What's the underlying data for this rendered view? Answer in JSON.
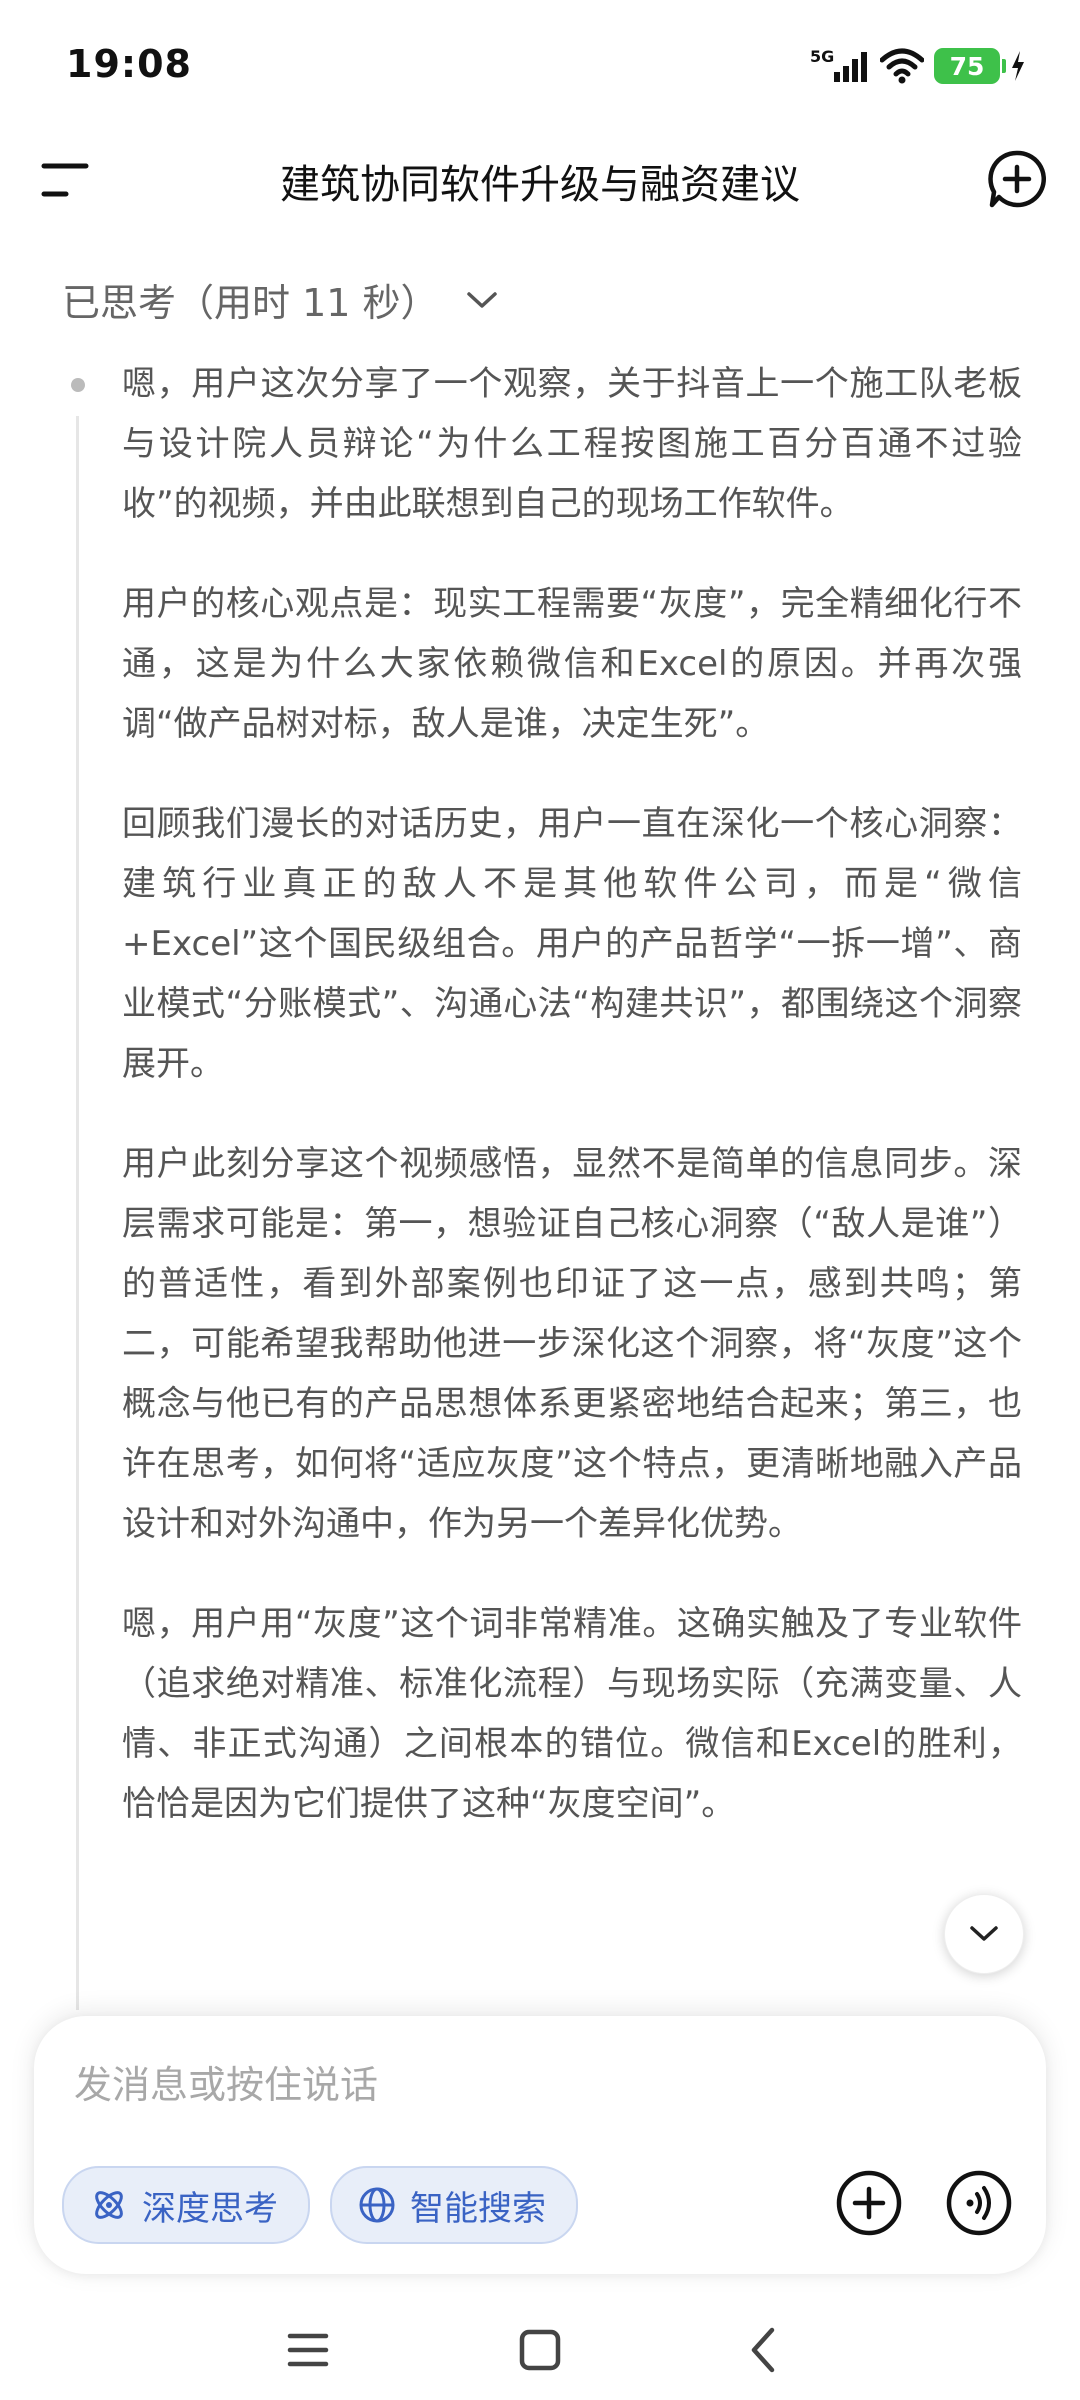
{
  "status_bar": {
    "time": "19:08",
    "network": "5G",
    "battery": "75"
  },
  "header": {
    "title": "建筑协同软件升级与融资建议"
  },
  "thinking": {
    "label": "已思考（用时 11 秒）",
    "paragraphs": [
      "嗯，用户这次分享了一个观察，关于抖音上一个施工队老板与设计院人员辩论“为什么工程按图施工百分百通不过验收”的视频，并由此联想到自己的现场工作软件。",
      "用户的核心观点是：现实工程需要“灰度”，完全精细化行不通，这是为什么大家依赖微信和Excel的原因。并再次强调“做产品树对标，敌人是谁，决定生死”。",
      "回顾我们漫长的对话历史，用户一直在深化一个核心洞察：建筑行业真正的敌人不是其他软件公司，而是“微信+Excel”这个国民级组合。用户的产品哲学“一拆一增”、商业模式“分账模式”、沟通心法“构建共识”，都围绕这个洞察展开。",
      "用户此刻分享这个视频感悟，显然不是简单的信息同步。深层需求可能是：第一，想验证自己核心洞察（“敌人是谁”）的普适性，看到外部案例也印证了这一点，感到共鸣；第二，可能希望我帮助他进一步深化这个洞察，将“灰度”这个概念与他已有的产品思想体系更紧密地结合起来；第三，也许在思考，如何将“适应灰度”这个特点，更清晰地融入产品设计和对外沟通中，作为另一个差异化优势。",
      "嗯，用户用“灰度”这个词非常精准。这确实触及了专业软件（追求绝对精准、标准化流程）与现场实际（充满变量、人情、非正式沟通）之间根本的错位。微信和Excel的胜利，恰恰是因为它们提供了这种“灰度空间”。"
    ]
  },
  "input": {
    "placeholder": "发消息或按住说话",
    "deep_think_label": "深度思考",
    "smart_search_label": "智能搜索"
  },
  "colors": {
    "accent": "#3a63c4",
    "chip_bg": "#e8eef9",
    "battery": "#3ec14a"
  },
  "icons": {
    "header_left": "menu-icon",
    "header_right": "new-chat-icon",
    "thinking_toggle": "chevron-down-icon",
    "scroll": "chevron-down-icon",
    "deep_think": "atom-icon",
    "smart_search": "globe-icon",
    "add": "plus-circle-icon",
    "voice": "voice-wave-icon",
    "nav": [
      "menu-icon",
      "home-square-icon",
      "back-icon"
    ]
  }
}
